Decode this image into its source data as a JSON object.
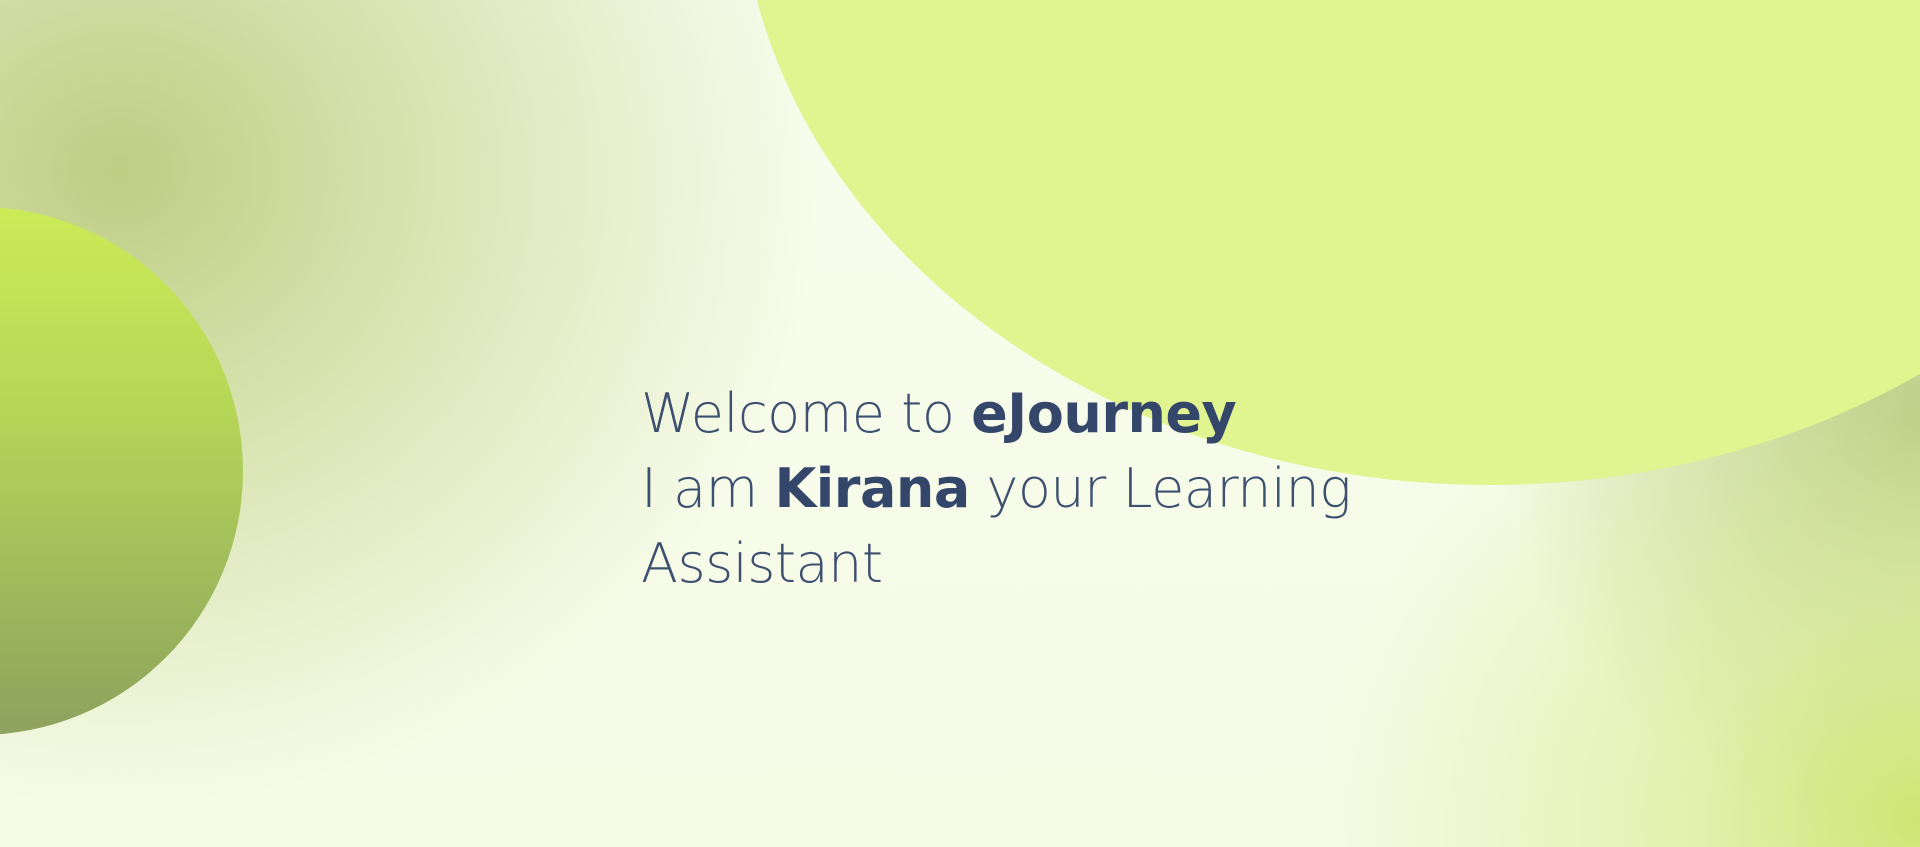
{
  "colors": {
    "text": "#34476a",
    "background": "#f7fbea",
    "accent_light": "#e0f48f",
    "accent_green": "#b6d658"
  },
  "welcome": {
    "line1_prefix": "Welcome to ",
    "brand": "eJourney",
    "line2_prefix": "I am ",
    "assistant_name": "Kirana",
    "line2_suffix": " your Learning",
    "line3": "Assistant"
  }
}
